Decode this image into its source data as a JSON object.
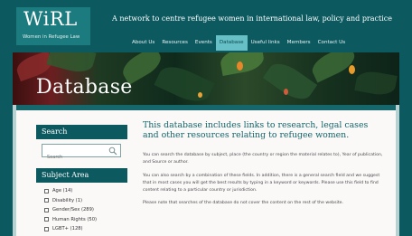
{
  "logo": {
    "title": "WiRL",
    "subtitle": "Women in Refugee Law"
  },
  "tagline": "A network to centre refugee women in international law, policy and practice",
  "nav": [
    {
      "label": "About Us",
      "active": false
    },
    {
      "label": "Resources",
      "active": false
    },
    {
      "label": "Events",
      "active": false
    },
    {
      "label": "Database",
      "active": true
    },
    {
      "label": "Useful links",
      "active": false
    },
    {
      "label": "Members",
      "active": false
    },
    {
      "label": "Contact Us",
      "active": false
    }
  ],
  "banner": {
    "title": "Database"
  },
  "sidebar": {
    "search_heading": "Search",
    "search_placeholder": "Search",
    "subject_heading": "Subject Area",
    "subjects": [
      "Age (14)",
      "Disability (1)",
      "Gender/Sex (289)",
      "Human Rights (50)",
      "LGBT+ (128)"
    ]
  },
  "main": {
    "heading": "This database includes links to research, legal cases and other resources relating to refugee women.",
    "paragraphs": [
      "You can search the database by subject, place (the country or region the material relates to), Year of publication, and Source or author.",
      "You can also search by a combination of these fields. In addition, there is a general search field and we suggest that in most cases you will get the best results by typing in a keyword or keywords. Please use this field to find content relating to a particular country or jurisdiction.",
      "Please note that searches of the database do not cover the content on the rest of the website."
    ]
  },
  "colors": {
    "teal_dark": "#0c5a60",
    "teal_active": "#67c0c6",
    "heading_teal": "#12656a",
    "background": "#b6d2d3"
  }
}
